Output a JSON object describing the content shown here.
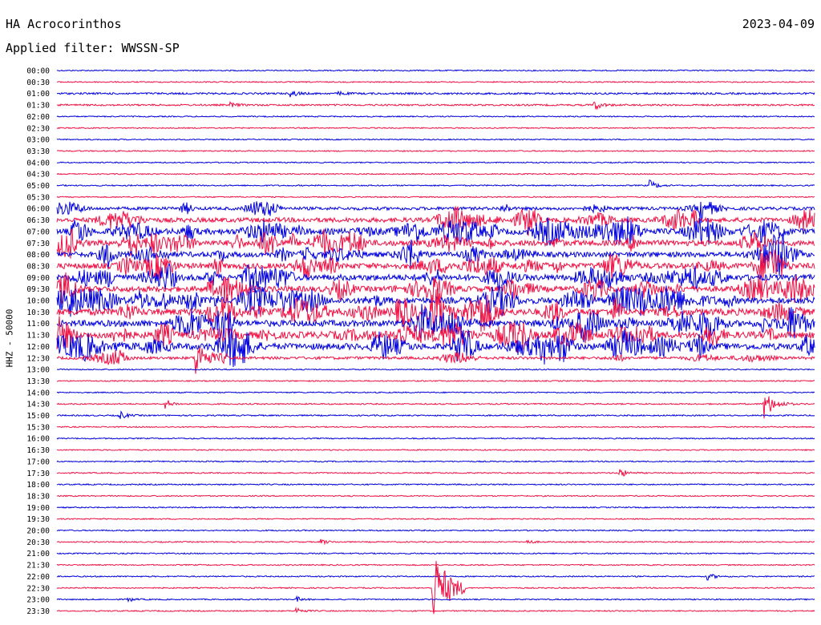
{
  "header": {
    "station": "HA Acrocorinthos",
    "date": "2023-04-09",
    "filter": "Applied filter: WWSSN-SP"
  },
  "colors": {
    "blue": "#0000dd",
    "red": "#ee1144"
  },
  "chart_data": {
    "type": "line",
    "title": "HA Acrocorinthos",
    "subtitle": "Applied filter: WWSSN-SP",
    "date": "2023-04-09",
    "ylabel": "HHZ - 50000",
    "tick_labels": [
      "00:00",
      "00:30",
      "01:00",
      "01:30",
      "02:00",
      "02:30",
      "03:00",
      "03:30",
      "04:00",
      "04:30",
      "05:00",
      "05:30",
      "06:00",
      "06:30",
      "07:00",
      "07:30",
      "08:00",
      "08:30",
      "09:00",
      "09:30",
      "10:00",
      "10:30",
      "11:00",
      "11:30",
      "12:00",
      "12:30",
      "13:00",
      "13:30",
      "14:00",
      "14:30",
      "15:00",
      "15:30",
      "16:00",
      "16:30",
      "17:00",
      "17:30",
      "18:00",
      "18:30",
      "19:00",
      "19:30",
      "20:00",
      "20:30",
      "21:00",
      "21:30",
      "22:00",
      "22:30",
      "23:00",
      "23:30"
    ],
    "trace_colors": [
      "blue",
      "red"
    ],
    "x_range_minutes": [
      0,
      30
    ],
    "activity": [
      0.05,
      0.05,
      0.25,
      0.2,
      0.05,
      0.04,
      0.04,
      0.05,
      0.04,
      0.05,
      0.08,
      0.05,
      0.6,
      1.0,
      1.4,
      1.3,
      1.2,
      1.3,
      1.4,
      1.3,
      1.5,
      1.6,
      1.5,
      1.6,
      1.5,
      0.5,
      0.06,
      0.05,
      0.05,
      0.1,
      0.1,
      0.05,
      0.05,
      0.05,
      0.06,
      0.06,
      0.08,
      0.05,
      0.05,
      0.05,
      0.07,
      0.06,
      0.07,
      0.06,
      0.07,
      0.06,
      0.07,
      0.06
    ],
    "events": [
      {
        "trace": "01:00",
        "minute": 9.3,
        "amp": 4
      },
      {
        "trace": "01:00",
        "minute": 11.2,
        "amp": 2
      },
      {
        "trace": "01:30",
        "minute": 6.9,
        "amp": 3
      },
      {
        "trace": "01:30",
        "minute": 21.3,
        "amp": 6
      },
      {
        "trace": "05:00",
        "minute": 23.5,
        "amp": 6
      },
      {
        "trace": "06:00",
        "minute": 25.5,
        "amp": 14
      },
      {
        "trace": "12:30",
        "minute": 5.5,
        "amp": 24
      },
      {
        "trace": "14:30",
        "minute": 4.3,
        "amp": 6
      },
      {
        "trace": "14:30",
        "minute": 28.0,
        "amp": 18
      },
      {
        "trace": "15:00",
        "minute": 2.5,
        "amp": 5
      },
      {
        "trace": "17:30",
        "minute": 22.3,
        "amp": 6
      },
      {
        "trace": "20:30",
        "minute": 10.5,
        "amp": 3
      },
      {
        "trace": "20:30",
        "minute": 18.6,
        "amp": 3
      },
      {
        "trace": "22:00",
        "minute": 25.8,
        "amp": 4
      },
      {
        "trace": "22:30",
        "minute": 14.9,
        "amp": 45
      },
      {
        "trace": "23:00",
        "minute": 2.8,
        "amp": 3
      },
      {
        "trace": "23:00",
        "minute": 9.5,
        "amp": 3
      },
      {
        "trace": "23:30",
        "minute": 9.5,
        "amp": 4
      }
    ]
  }
}
